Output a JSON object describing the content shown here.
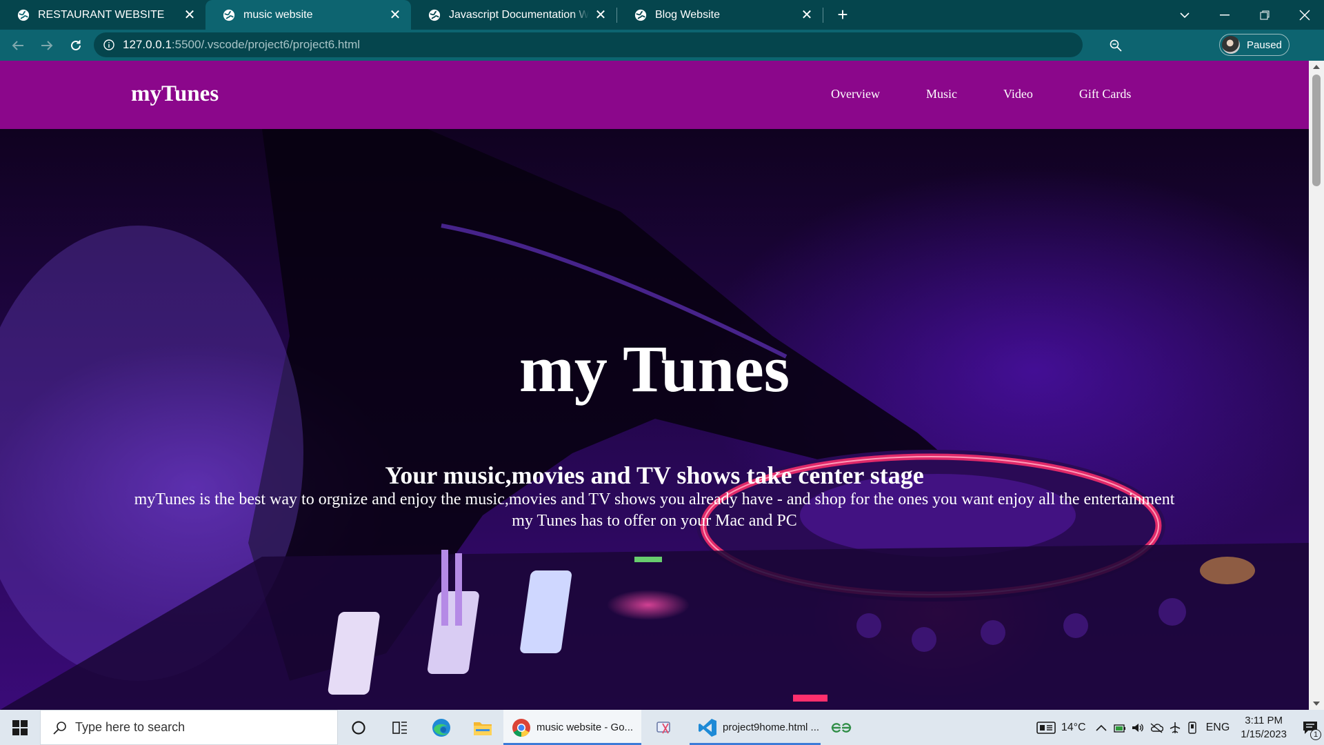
{
  "browser": {
    "tabs": [
      {
        "title": "RESTAURANT WEBSITE",
        "active": false
      },
      {
        "title": "music website",
        "active": true
      },
      {
        "title": "Javascript Documentation Website",
        "active": false
      },
      {
        "title": "Blog Website",
        "active": false
      }
    ],
    "url_host": "127.0.0.1",
    "url_rest": ":5500/.vscode/project6/project6.html",
    "profile_status": "Paused",
    "colors": {
      "frame": "#05454d",
      "toolbar": "#0d6470"
    }
  },
  "site": {
    "brand": "myTunes",
    "nav": [
      "Overview",
      "Music",
      "Video",
      "Gift Cards"
    ],
    "nav_color": "#8b078b"
  },
  "hero": {
    "title": "my Tunes",
    "subtitle": "Your music,movies and TV shows take center stage",
    "body": "myTunes is the best way to orgnize and enjoy the music,movies and TV shows you already have - and shop for the ones you want enjoy all the entertainment my Tunes has to offer on your Mac and PC"
  },
  "taskbar": {
    "search_placeholder": "Type here to search",
    "apps": [
      {
        "label": "music website - Go...",
        "icon": "chrome-icon",
        "active": true
      },
      {
        "label": "project9home.html ...",
        "icon": "vscode-icon",
        "active": false
      }
    ],
    "temperature": "14°C",
    "language": "ENG",
    "time": "3:11 PM",
    "date": "1/15/2023",
    "notification_count": "1"
  }
}
